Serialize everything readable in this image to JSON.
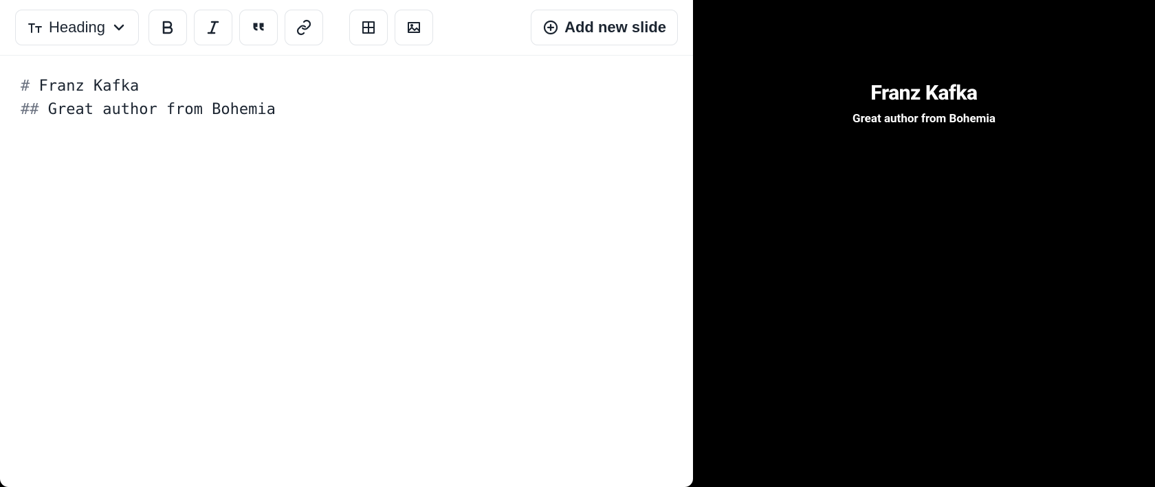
{
  "toolbar": {
    "heading_label": "Heading",
    "add_slide_label": "Add new slide"
  },
  "editor": {
    "line1_marker": "# ",
    "line1_text": "Franz Kafka",
    "line2_marker": "## ",
    "line2_text": "Great author from Bohemia"
  },
  "preview": {
    "title": "Franz Kafka",
    "subtitle": "Great author from Bohemia"
  }
}
